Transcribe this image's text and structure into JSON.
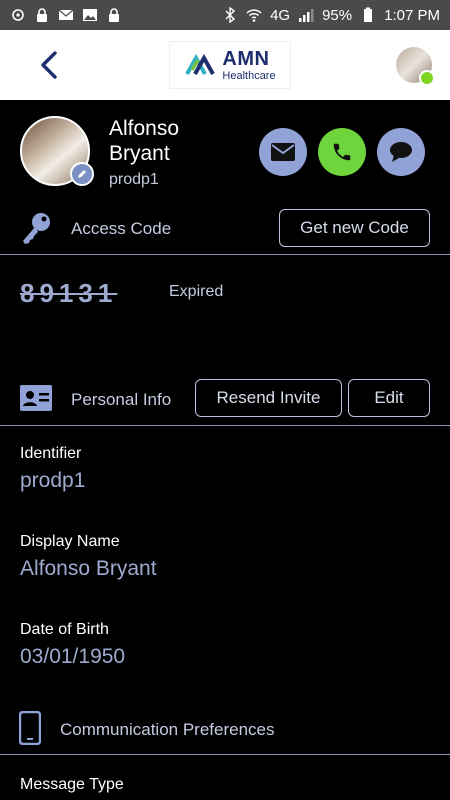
{
  "status_bar": {
    "battery": "95%",
    "time": "1:07 PM",
    "network": "4G"
  },
  "header": {
    "back_icon": "chevron-left-icon",
    "logo_brand": "AMN",
    "logo_sub": "Healthcare"
  },
  "profile": {
    "name": "Alfonso Bryant",
    "username": "prodp1"
  },
  "access_code": {
    "label": "Access Code",
    "button": "Get new Code",
    "code": "89131",
    "status": "Expired"
  },
  "personal_info": {
    "label": "Personal Info",
    "resend_button": "Resend Invite",
    "edit_button": "Edit",
    "fields": [
      {
        "label": "Identifier",
        "value": "prodp1"
      },
      {
        "label": "Display Name",
        "value": "Alfonso Bryant"
      },
      {
        "label": "Date of Birth",
        "value": "03/01/1950"
      }
    ]
  },
  "communication": {
    "label": "Communication Preferences",
    "message_type_label": "Message Type"
  },
  "colors": {
    "accent": "#91a3d6",
    "call_green": "#6ed53d",
    "brand_navy": "#1d2e6e"
  }
}
